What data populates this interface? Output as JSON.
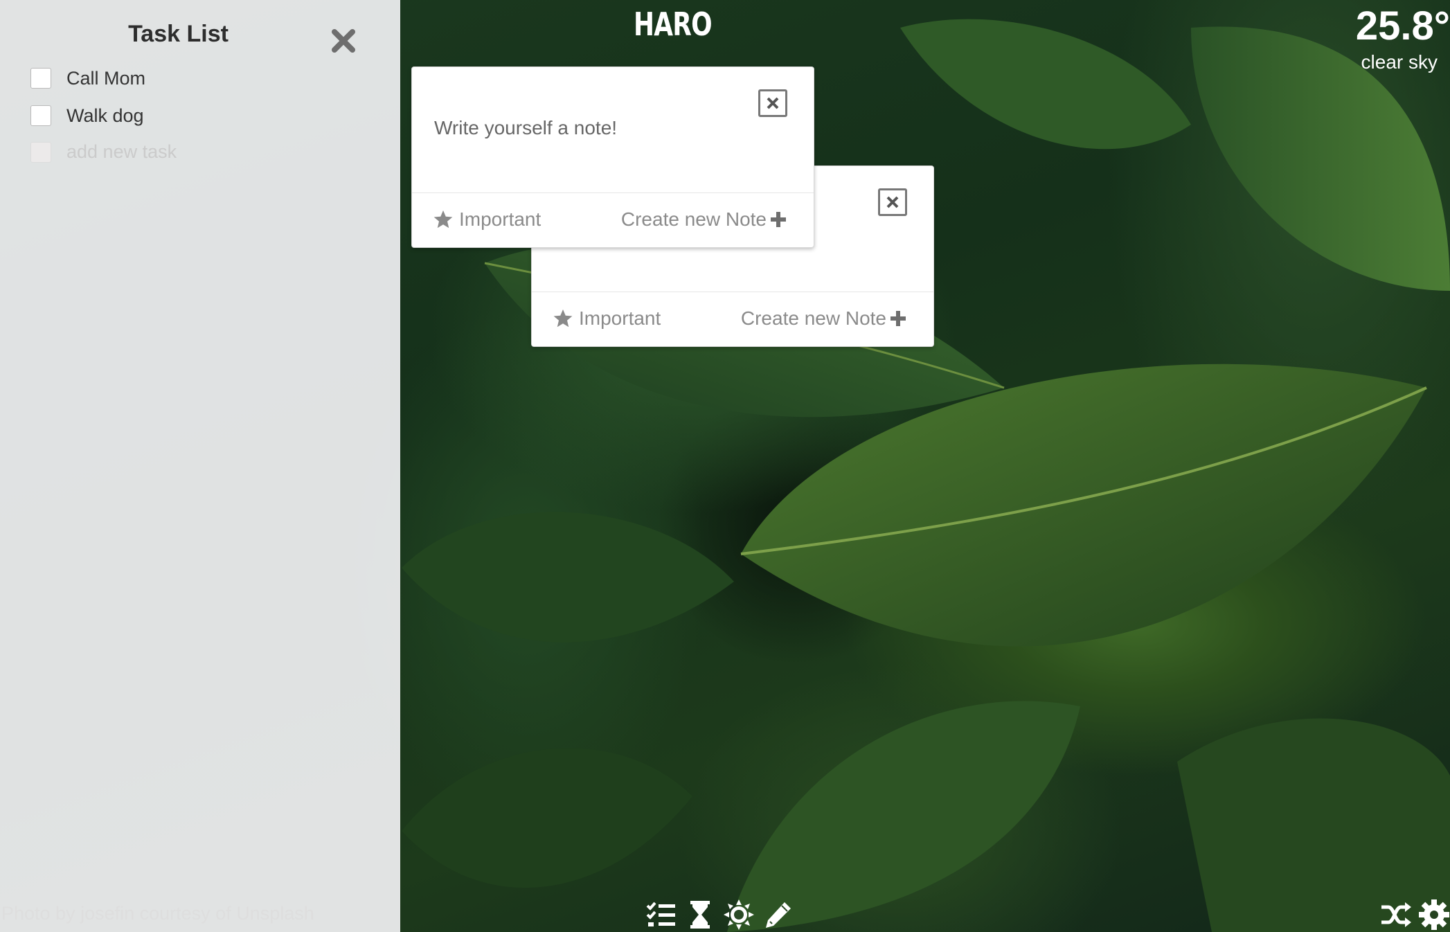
{
  "background": {
    "photo_credit": "Photo by josefin courtesy of Unsplash"
  },
  "header": {
    "logo": "HARO",
    "temperature": "25.8°",
    "weather_description": "clear sky"
  },
  "task_list": {
    "title": "Task List",
    "close_icon": "close-x-icon",
    "tasks": [
      {
        "label": "Call Mom",
        "checked": false
      },
      {
        "label": "Walk dog",
        "checked": false
      }
    ],
    "new_task_placeholder": "add new task"
  },
  "notes": [
    {
      "placeholder": "Write yourself a note!",
      "important_label": "Important",
      "create_label": "Create new Note"
    },
    {
      "placeholder": "",
      "important_label": "Important",
      "create_label": "Create new Note"
    }
  ],
  "toolbar": {
    "center_icons": [
      "task-list-icon",
      "hourglass-icon",
      "sun-icon",
      "pencil-icon"
    ],
    "right_icons": [
      "shuffle-icon",
      "settings-gear-icon"
    ]
  },
  "colors": {
    "panel_bg": "#f0f0f2",
    "note_bg": "#ffffff",
    "muted_text": "#8a8a8a",
    "icon_white": "#ffffff"
  }
}
